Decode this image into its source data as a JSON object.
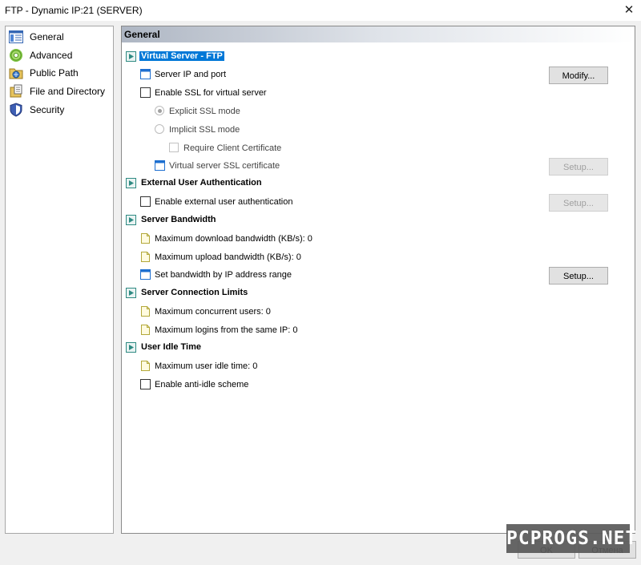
{
  "window": {
    "title": "FTP - Dynamic IP:21 (SERVER)",
    "close_symbol": "✕"
  },
  "sidebar": {
    "items": [
      {
        "label": "General",
        "icon": "general-icon"
      },
      {
        "label": "Advanced",
        "icon": "gear-icon"
      },
      {
        "label": "Public Path",
        "icon": "folder-icon"
      },
      {
        "label": "File and Directory",
        "icon": "file-icon"
      },
      {
        "label": "Security",
        "icon": "shield-icon"
      }
    ]
  },
  "panel": {
    "title": "General",
    "sections": {
      "virtual_server": {
        "label": "Virtual Server - FTP",
        "server_ip": "Server IP and port",
        "enable_ssl": "Enable SSL for virtual server",
        "explicit_ssl": "Explicit SSL mode",
        "implicit_ssl": "Implicit SSL mode",
        "require_cert": "Require Client Certificate",
        "ssl_cert": "Virtual server SSL certificate"
      },
      "external_auth": {
        "label": "External User Authentication",
        "enable": "Enable external user authentication"
      },
      "bandwidth": {
        "label": "Server Bandwidth",
        "max_download": "Maximum download bandwidth (KB/s): 0",
        "max_upload": "Maximum upload bandwidth (KB/s): 0",
        "by_ip": "Set bandwidth by IP address range"
      },
      "connection_limits": {
        "label": "Server Connection Limits",
        "max_users": "Maximum concurrent users: 0",
        "max_logins_ip": "Maximum logins from the same IP: 0"
      },
      "idle": {
        "label": "User Idle Time",
        "max_idle": "Maximum user idle time: 0",
        "anti_idle": "Enable anti-idle scheme"
      }
    },
    "buttons": {
      "modify": "Modify...",
      "setup": "Setup..."
    }
  },
  "footer": {
    "ok": "OK",
    "cancel": "Отмена"
  },
  "watermark": "PCPROGS.NET",
  "colors": {
    "selection": "#0078d7",
    "section_icon": "#2e8a82",
    "blue_icon": "#1d6fd0",
    "note_icon": "#b3a83a"
  }
}
